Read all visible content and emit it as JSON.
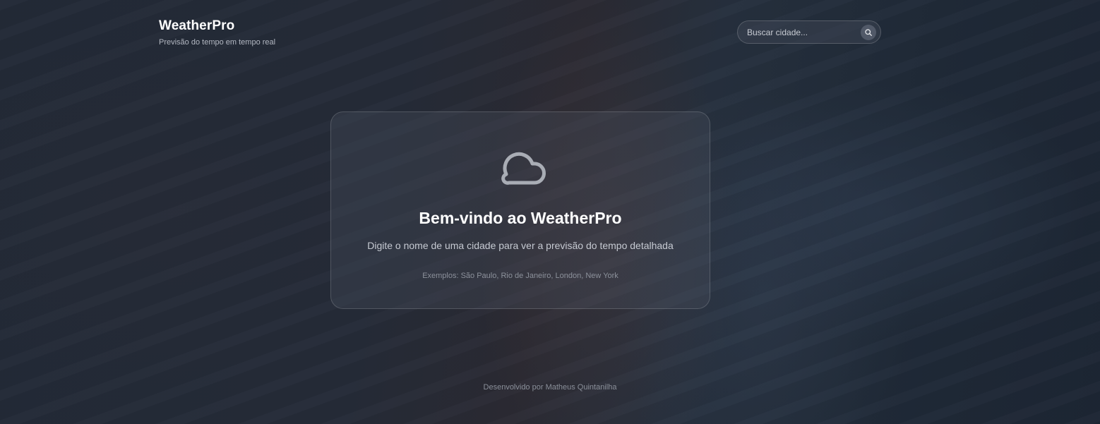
{
  "header": {
    "title": "WeatherPro",
    "subtitle": "Previsão do tempo em tempo real"
  },
  "search": {
    "placeholder": "Buscar cidade...",
    "value": "",
    "icon": "search-icon"
  },
  "welcome": {
    "icon": "cloud-icon",
    "title": "Bem-vindo ao WeatherPro",
    "description": "Digite o nome de uma cidade para ver a previsão do tempo detalhada",
    "examples": "Exemplos: São Paulo, Rio de Janeiro, London, New York"
  },
  "footer": {
    "text": "Desenvolvido por Matheus Quintanilha"
  },
  "colors": {
    "background": "#1f2633",
    "text_primary": "#ffffff",
    "text_secondary": "#c6cad2",
    "text_muted": "#8c919b"
  }
}
